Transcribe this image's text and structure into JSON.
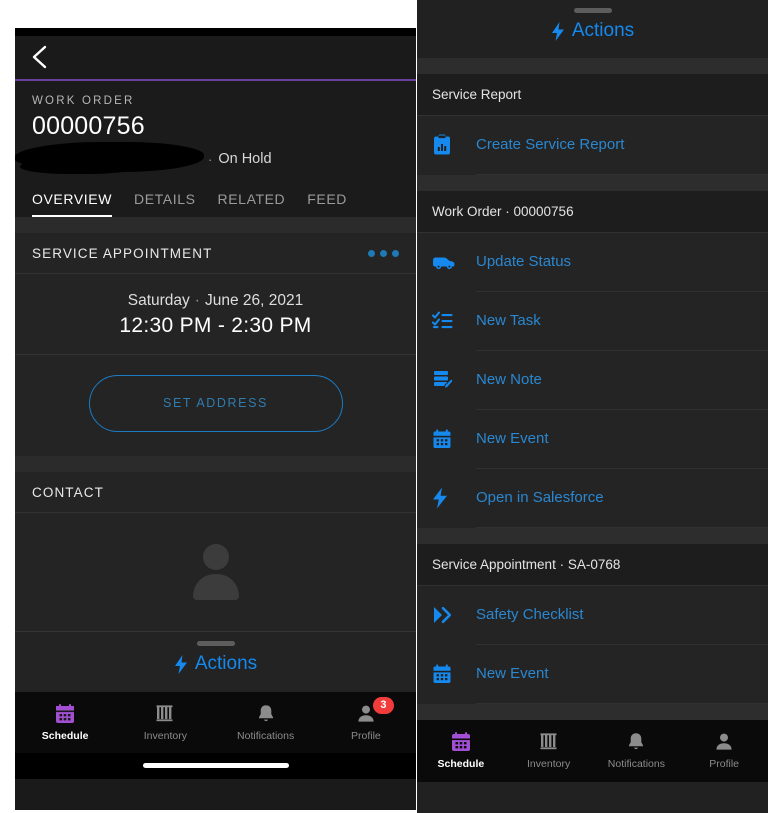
{
  "left": {
    "nav": {
      "back_icon": "chevron-left-icon"
    },
    "record": {
      "type_label": "WORK ORDER",
      "number": "00000756",
      "separator": "·",
      "status": "On Hold"
    },
    "tabs": [
      {
        "label": "OVERVIEW",
        "active": true
      },
      {
        "label": "DETAILS",
        "active": false
      },
      {
        "label": "RELATED",
        "active": false
      },
      {
        "label": "FEED",
        "active": false
      }
    ],
    "service_appointment": {
      "title": "SERVICE APPOINTMENT",
      "overflow_icon": "more-horizontal-icon",
      "day": "Saturday",
      "date_separator": "·",
      "date": "June 26, 2021",
      "time_range": "12:30 PM - 2:30 PM",
      "action_button": "SET ADDRESS"
    },
    "contact": {
      "title": "CONTACT",
      "avatar_icon": "person-placeholder-icon"
    },
    "sheet_peek": {
      "icon": "lightning-bolt-icon",
      "label": "Actions"
    },
    "tabbar": [
      {
        "label": "Schedule",
        "icon": "calendar-icon",
        "active": true,
        "badge": ""
      },
      {
        "label": "Inventory",
        "icon": "inventory-icon",
        "active": false,
        "badge": ""
      },
      {
        "label": "Notifications",
        "icon": "bell-icon",
        "active": false,
        "badge": ""
      },
      {
        "label": "Profile",
        "icon": "person-icon",
        "active": false,
        "badge": "3"
      }
    ]
  },
  "right": {
    "sheet": {
      "icon": "lightning-bolt-icon",
      "title": "Actions"
    },
    "sections": [
      {
        "header": "Service Report",
        "items": [
          {
            "label": "Create Service Report",
            "icon": "clipboard-chart-icon"
          }
        ]
      },
      {
        "header": "Work Order · 00000756",
        "items": [
          {
            "label": "Update Status",
            "icon": "truck-icon"
          },
          {
            "label": "New Task",
            "icon": "checklist-icon"
          },
          {
            "label": "New Note",
            "icon": "note-edit-icon"
          },
          {
            "label": "New Event",
            "icon": "calendar-icon"
          },
          {
            "label": "Open in Salesforce",
            "icon": "lightning-bolt-icon"
          }
        ]
      },
      {
        "header": "Service Appointment · SA-0768",
        "items": [
          {
            "label": "Safety Checklist",
            "icon": "double-chevron-right-icon"
          },
          {
            "label": "New Event",
            "icon": "calendar-icon"
          }
        ]
      }
    ],
    "tabbar": [
      {
        "label": "Schedule",
        "icon": "calendar-icon",
        "active": true,
        "badge": ""
      },
      {
        "label": "Inventory",
        "icon": "inventory-icon",
        "active": false,
        "badge": ""
      },
      {
        "label": "Notifications",
        "icon": "bell-icon",
        "active": false,
        "badge": ""
      },
      {
        "label": "Profile",
        "icon": "person-icon",
        "active": false,
        "badge": ""
      }
    ]
  },
  "colors": {
    "accent_blue": "#1589ee",
    "link_blue": "#2a87d0",
    "accent_purple": "#6b3fa0",
    "nav_purple": "#a24fd4",
    "badge_red": "#f23b3b",
    "panel_bg": "#212121",
    "card_bg": "#242424"
  }
}
